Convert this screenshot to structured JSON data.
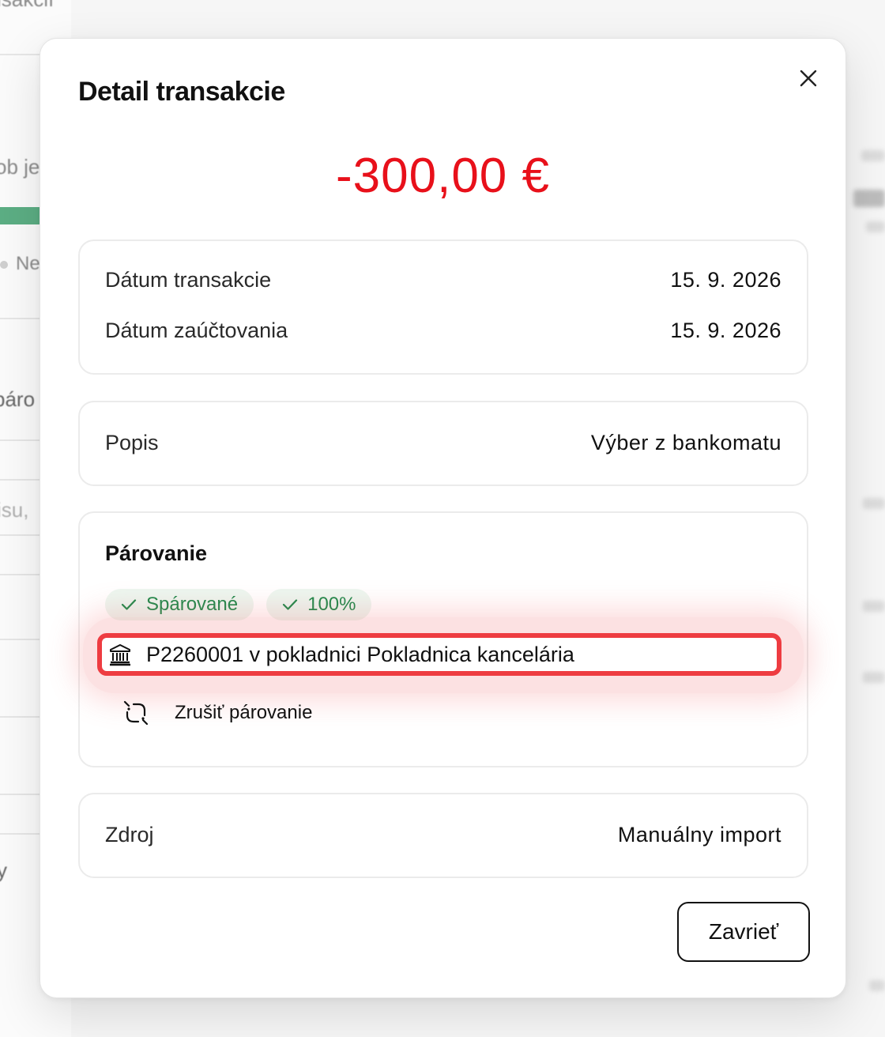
{
  "background": {
    "fragments": [
      "isakcií",
      "ob je",
      "Ne",
      "páro",
      "isu,",
      "y"
    ]
  },
  "modal": {
    "title": "Detail transakcie",
    "amount": "-300,00 €",
    "amount_color": "#e8101a",
    "dates": {
      "transaction_label": "Dátum transakcie",
      "transaction_value": "15. 9. 2026",
      "posting_label": "Dátum zaúčtovania",
      "posting_value": "15. 9. 2026"
    },
    "description": {
      "label": "Popis",
      "value": "Výber z bankomatu"
    },
    "pairing": {
      "title": "Párovanie",
      "status_badge": "Spárované",
      "match_badge": "100%",
      "linked_document": "P2260001 v pokladnici Pokladnica kancelária",
      "unpair_label": "Zrušiť párovanie",
      "badge_color": "#1f8a4c",
      "highlight_color": "#ee3c41"
    },
    "source": {
      "label": "Zdroj",
      "value": "Manuálny import"
    },
    "close_button": "Zavrieť",
    "icons": {
      "close": "close-icon",
      "check": "check-icon",
      "bank": "bank-icon",
      "unlink": "unlink-icon"
    }
  }
}
